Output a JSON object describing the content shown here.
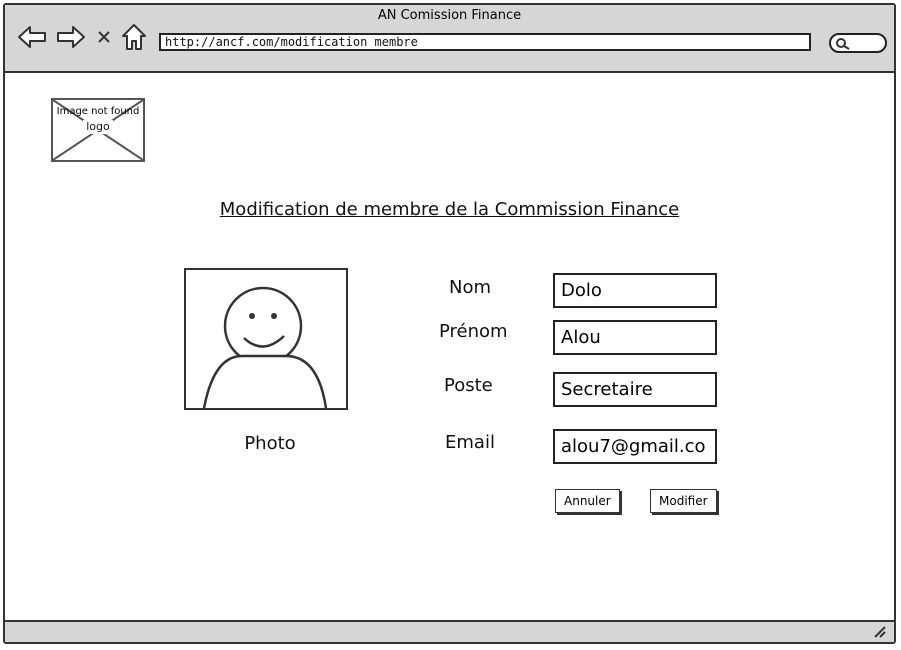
{
  "window": {
    "title": "AN Comission Finance"
  },
  "browser": {
    "url": "http://ancf.com/modification membre",
    "back_icon": "back-arrow-icon",
    "forward_icon": "forward-arrow-icon",
    "close_icon": "close-icon",
    "home_icon": "home-icon",
    "search_icon": "search-icon"
  },
  "logo": {
    "placeholder_text": "Image not found",
    "label": "logo"
  },
  "page": {
    "title": "Modification de membre de la Commission Finance"
  },
  "photo": {
    "label": "Photo"
  },
  "form": {
    "fields": [
      {
        "label": "Nom",
        "value": "Dolo"
      },
      {
        "label": "Prénom",
        "value": "Alou"
      },
      {
        "label": "Poste",
        "value": "Secretaire"
      },
      {
        "label": "Email",
        "value": "alou7@gmail.co"
      }
    ],
    "cancel_label": "Annuler",
    "submit_label": "Modifier"
  }
}
